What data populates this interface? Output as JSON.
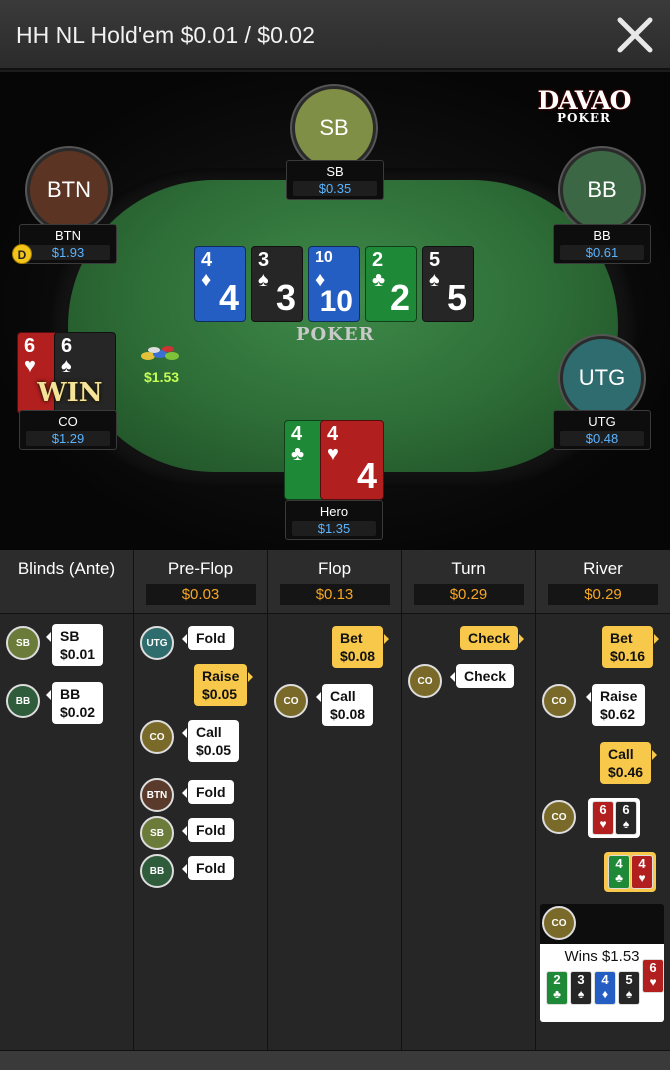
{
  "header": {
    "title": "HH NL Hold'em $0.01 / $0.02"
  },
  "brand": {
    "line1": "DAVAO",
    "line2": "POKER"
  },
  "table": {
    "felt_logo": "POKER",
    "dealer_label": "D"
  },
  "seats": [
    {
      "label": "SB",
      "name": "SB",
      "stack": "$0.35",
      "color": "#7f8f45"
    },
    {
      "label": "BTN",
      "name": "BTN",
      "stack": "$1.93",
      "color": "#5c3424"
    },
    {
      "label": "BB",
      "name": "BB",
      "stack": "$0.61",
      "color": "#3c6744"
    },
    {
      "label": "UTG",
      "name": "UTG",
      "stack": "$0.48",
      "color": "#2f6c70"
    },
    {
      "name": "CO",
      "stack": "$1.29"
    },
    {
      "name": "Hero",
      "stack": "$1.35"
    }
  ],
  "board": [
    {
      "rank": "4",
      "suit": "♦",
      "color": "blue"
    },
    {
      "rank": "3",
      "suit": "♠",
      "color": "black"
    },
    {
      "rank": "10",
      "suit": "♦",
      "color": "blue"
    },
    {
      "rank": "2",
      "suit": "♣",
      "color": "green"
    },
    {
      "rank": "5",
      "suit": "♠",
      "color": "black"
    }
  ],
  "co_cards": [
    {
      "rank": "6",
      "suit": "♥",
      "color": "red"
    },
    {
      "rank": "6",
      "suit": "♠",
      "color": "black"
    }
  ],
  "hero_cards": [
    {
      "rank": "4",
      "suit": "♣",
      "color": "green"
    },
    {
      "rank": "4",
      "suit": "♥",
      "color": "red"
    }
  ],
  "win_label": "WIN",
  "pot_chips": "$1.53",
  "streets": [
    {
      "name": "Blinds (Ante)",
      "pot": ""
    },
    {
      "name": "Pre-Flop",
      "pot": "$0.03"
    },
    {
      "name": "Flop",
      "pot": "$0.13"
    },
    {
      "name": "Turn",
      "pot": "$0.29"
    },
    {
      "name": "River",
      "pot": "$0.29"
    }
  ],
  "actions": {
    "blinds": [
      {
        "who": "SB",
        "text1": "SB",
        "text2": "$0.01"
      },
      {
        "who": "BB",
        "text1": "BB",
        "text2": "$0.02"
      }
    ],
    "preflop": [
      {
        "who": "UTG",
        "text1": "Fold"
      },
      {
        "hero": true,
        "text1": "Raise",
        "text2": "$0.05"
      },
      {
        "who": "CO",
        "text1": "Call",
        "text2": "$0.05"
      },
      {
        "who": "BTN",
        "text1": "Fold"
      },
      {
        "who": "SB",
        "text1": "Fold"
      },
      {
        "who": "BB",
        "text1": "Fold"
      }
    ],
    "flop": [
      {
        "hero": true,
        "text1": "Bet",
        "text2": "$0.08"
      },
      {
        "who": "CO",
        "text1": "Call",
        "text2": "$0.08"
      }
    ],
    "turn": [
      {
        "hero": true,
        "text1": "Check"
      },
      {
        "who": "CO",
        "text1": "Check"
      }
    ],
    "river": [
      {
        "hero": true,
        "text1": "Bet",
        "text2": "$0.16"
      },
      {
        "who": "CO",
        "text1": "Raise",
        "text2": "$0.62"
      },
      {
        "hero": true,
        "text1": "Call",
        "text2": "$0.46"
      }
    ]
  },
  "showdown": {
    "co_cards": [
      {
        "rank": "6",
        "suit": "♥"
      },
      {
        "rank": "6",
        "suit": "♠"
      }
    ],
    "hero_cards": [
      {
        "rank": "4",
        "suit": "♣"
      },
      {
        "rank": "4",
        "suit": "♥"
      }
    ],
    "win_text": "Wins $1.53",
    "best_hand": [
      {
        "rank": "2",
        "suit": "♣",
        "color": "#1e8a37"
      },
      {
        "rank": "3",
        "suit": "♠",
        "color": "#262626"
      },
      {
        "rank": "4",
        "suit": "♦",
        "color": "#245ec3"
      },
      {
        "rank": "5",
        "suit": "♠",
        "color": "#262626"
      },
      {
        "rank": "6",
        "suit": "♥",
        "color": "#b11f1f"
      }
    ]
  },
  "colors": {
    "stack": "#5ab3ff",
    "pot": "#f6a623",
    "hero_bubble": "#f7c84a",
    "chips_amount": "#c6ff54"
  }
}
